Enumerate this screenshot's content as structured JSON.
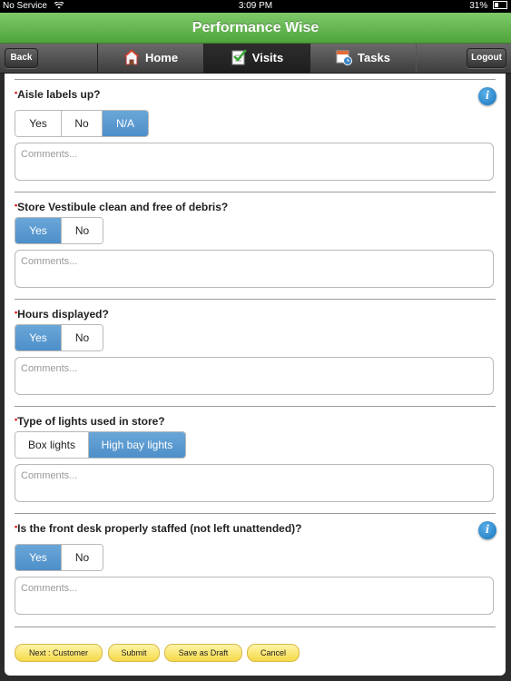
{
  "status_bar": {
    "carrier": "No Service",
    "time": "3:09 PM",
    "battery": "31%"
  },
  "app": {
    "title": "Performance Wise"
  },
  "nav": {
    "back_label": "Back",
    "logout_label": "Logout",
    "tabs": [
      {
        "label": "Home",
        "icon": "home-icon"
      },
      {
        "label": "Visits",
        "icon": "checklist-icon",
        "active": true
      },
      {
        "label": "Tasks",
        "icon": "calendar-clock-icon"
      }
    ]
  },
  "questions": [
    {
      "label": "Aisle labels up?",
      "options": [
        "Yes",
        "No",
        "N/A"
      ],
      "selected": "N/A",
      "has_info": true,
      "comment_placeholder": "Comments..."
    },
    {
      "label": "Store Vestibule clean and free of debris?",
      "options": [
        "Yes",
        "No"
      ],
      "selected": "Yes",
      "has_info": false,
      "comment_placeholder": "Comments..."
    },
    {
      "label": "Hours displayed?",
      "options": [
        "Yes",
        "No"
      ],
      "selected": "Yes",
      "has_info": false,
      "comment_placeholder": "Comments..."
    },
    {
      "label": "Type of lights used in store?",
      "options": [
        "Box lights",
        "High bay lights"
      ],
      "selected": "High bay lights",
      "has_info": false,
      "comment_placeholder": "Comments..."
    },
    {
      "label": "Is the front desk properly staffed (not left unattended)?",
      "options": [
        "Yes",
        "No"
      ],
      "selected": "Yes",
      "has_info": true,
      "comment_placeholder": "Comments..."
    }
  ],
  "footer": {
    "next_label": "Next : Customer",
    "submit_label": "Submit",
    "draft_label": "Save as Draft",
    "cancel_label": "Cancel"
  },
  "colors": {
    "title_green": "#5fb44a",
    "selected_blue": "#5b9bd5",
    "button_yellow": "#f7df5a",
    "info_blue": "#1f80c8"
  }
}
